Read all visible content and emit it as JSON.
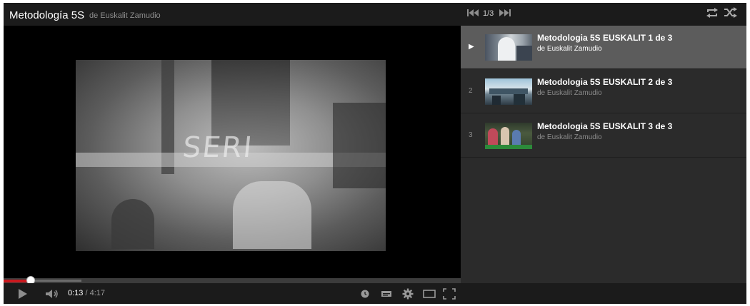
{
  "player": {
    "title": "Metodología 5S",
    "byline": "de Euskalit Zamudio"
  },
  "video": {
    "overlay_text": "SERI",
    "current_time": "0:13",
    "separator": "/",
    "duration": "4:17",
    "progress": {
      "played_fraction": 0.06,
      "buffered_fraction": 0.17
    }
  },
  "playlist": {
    "position": "1/3",
    "items": [
      {
        "index": "▶",
        "title": "Metodologia 5S EUSKALIT 1 de 3",
        "owner": "de Euskalit Zamudio",
        "active": true
      },
      {
        "index": "2",
        "title": "Metodologia 5S EUSKALIT 2 de 3",
        "owner": "de Euskalit Zamudio",
        "active": false
      },
      {
        "index": "3",
        "title": "Metodologia 5S EUSKALIT 3 de 3",
        "owner": "de Euskalit Zamudio",
        "active": false
      }
    ]
  },
  "icons": {
    "prev": "skip-previous-icon",
    "next": "skip-next-icon",
    "loop": "loop-icon",
    "shuffle": "shuffle-icon",
    "play": "play-icon",
    "volume": "volume-icon",
    "watch_later": "clock-icon",
    "captions": "captions-icon",
    "settings": "gear-icon",
    "size": "theater-mode-icon",
    "fullscreen": "fullscreen-icon"
  },
  "colors": {
    "accent": "#cc181e",
    "background": "#1b1b1b",
    "playlist_bg": "#2b2b2b",
    "active_item": "#5c5c5c"
  }
}
